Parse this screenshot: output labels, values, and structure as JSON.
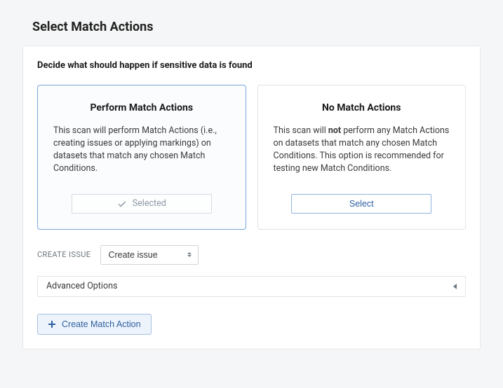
{
  "page": {
    "title": "Select Match Actions"
  },
  "panel": {
    "subtitle": "Decide what should happen if sensitive data is found",
    "cards": {
      "perform": {
        "title": "Perform Match Actions",
        "desc": "This scan will perform Match Actions (i.e., creating issues or applying markings) on datasets that match any chosen Match Conditions.",
        "btn": "Selected"
      },
      "none": {
        "title": "No Match Actions",
        "desc_pre": "This scan will ",
        "desc_bold": "not",
        "desc_post": " perform any Match Actions on datasets that match any chosen Match Conditions. This option is recommended for testing new Match Conditions.",
        "btn": "Select"
      }
    },
    "createIssue": {
      "label": "CREATE ISSUE",
      "value": "Create issue"
    },
    "advanced": {
      "label": "Advanced Options"
    },
    "createAction": {
      "label": "Create Match Action"
    }
  }
}
